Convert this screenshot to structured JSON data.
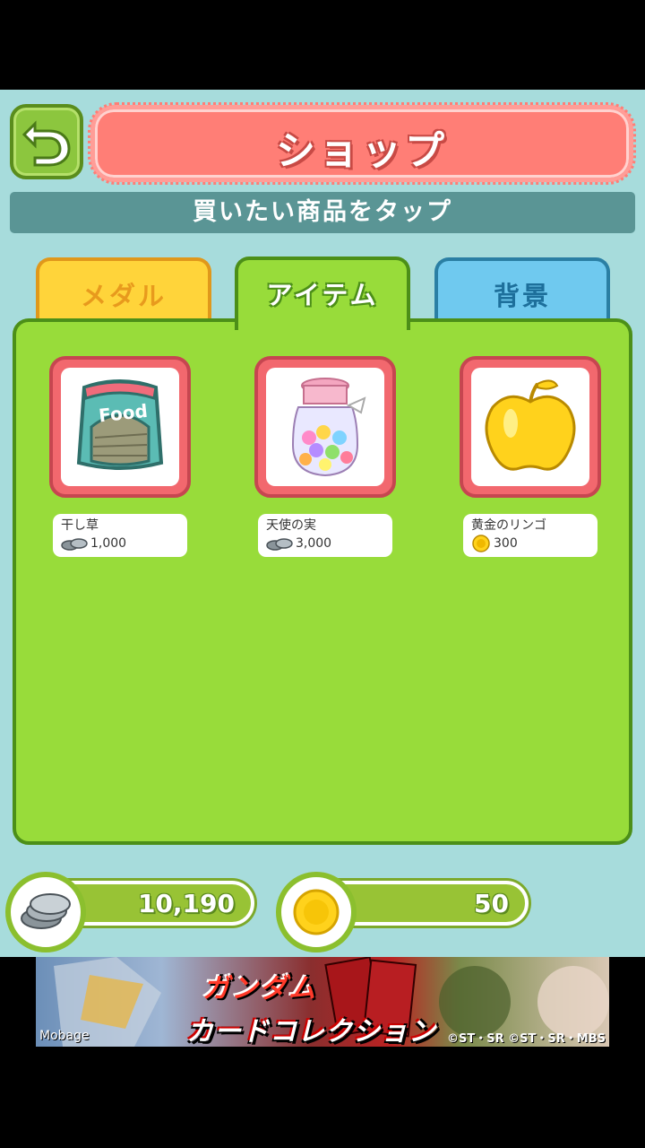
{
  "header": {
    "title": "ショップ",
    "subtitle": "買いたい商品をタップ"
  },
  "tabs": [
    {
      "label": "メダル",
      "active": false
    },
    {
      "label": "アイテム",
      "active": true
    },
    {
      "label": "背景",
      "active": false
    }
  ],
  "items": [
    {
      "name": "干し草",
      "price": "1,000",
      "currency": "silver-coin-icon",
      "image": "food-bag-icon"
    },
    {
      "name": "天使の実",
      "price": "3,000",
      "currency": "silver-coin-icon",
      "image": "candy-jar-icon"
    },
    {
      "name": "黄金のリンゴ",
      "price": "300",
      "currency": "gold-medal-icon",
      "image": "golden-apple-icon"
    }
  ],
  "wallet": {
    "coins": "10,190",
    "medals": "50"
  },
  "ad": {
    "title_line1": "ガンダム",
    "title_line2": "カードコレクション",
    "brand": "Mobage",
    "copyright": "©ST・SR ©ST・SR・MBS"
  },
  "colors": {
    "screen_bg": "#a7dcdc",
    "panel_green": "#98dc3a",
    "title_pink": "#ff7e76",
    "subtitle_teal": "#5a9595"
  }
}
